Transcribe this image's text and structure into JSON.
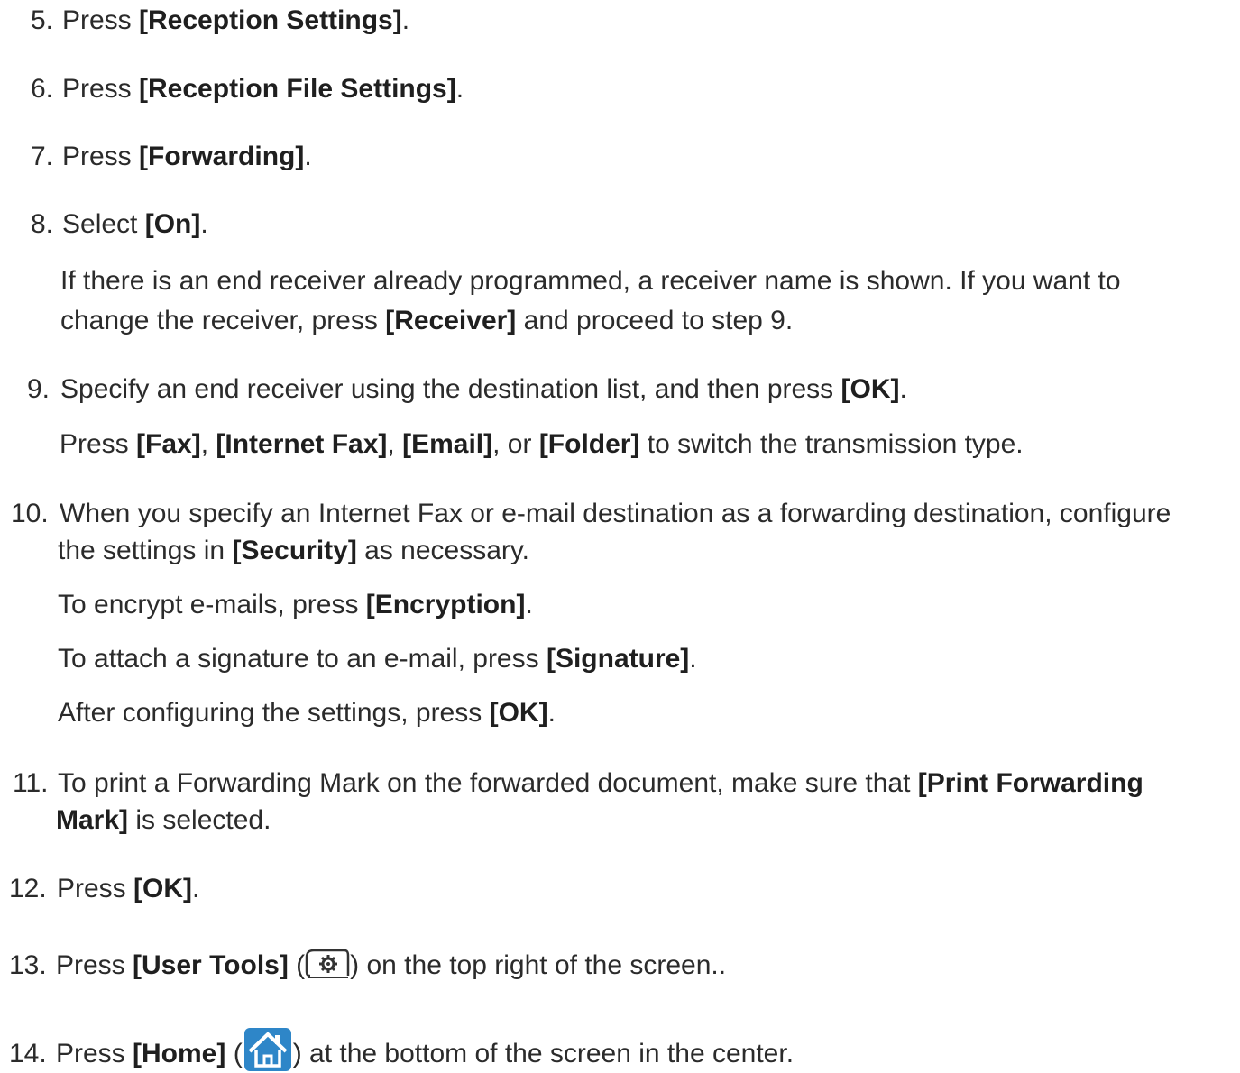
{
  "steps": [
    {
      "num": "5.",
      "parts": [
        {
          "t": "Press "
        },
        {
          "t": "[Reception Settings]",
          "b": true
        },
        {
          "t": "."
        }
      ]
    },
    {
      "num": "6.",
      "parts": [
        {
          "t": "Press "
        },
        {
          "t": "[Reception File Settings]",
          "b": true
        },
        {
          "t": "."
        }
      ]
    },
    {
      "num": "7.",
      "parts": [
        {
          "t": "Press "
        },
        {
          "t": "[Forwarding]",
          "b": true
        },
        {
          "t": "."
        }
      ]
    },
    {
      "num": "8.",
      "parts": [
        {
          "t": "Select "
        },
        {
          "t": "[On]",
          "b": true
        },
        {
          "t": "."
        }
      ]
    },
    {
      "num": "",
      "parts": [
        {
          "t": "If there is an end receiver already programmed, a receiver name is shown. If you want to"
        }
      ]
    },
    {
      "num": "",
      "parts": [
        {
          "t": "change the receiver, press "
        },
        {
          "t": "[Receiver]",
          "b": true
        },
        {
          "t": " and proceed to step 9."
        }
      ]
    },
    {
      "num": "9.",
      "parts": [
        {
          "t": "Specify an end receiver using the destination list, and then press "
        },
        {
          "t": "[OK]",
          "b": true
        },
        {
          "t": "."
        }
      ]
    },
    {
      "num": "",
      "parts": [
        {
          "t": "Press "
        },
        {
          "t": "[Fax]",
          "b": true
        },
        {
          "t": ", "
        },
        {
          "t": "[Internet Fax]",
          "b": true
        },
        {
          "t": ", "
        },
        {
          "t": "[Email]",
          "b": true
        },
        {
          "t": ", or "
        },
        {
          "t": "[Folder]",
          "b": true
        },
        {
          "t": " to switch the transmission type."
        }
      ]
    },
    {
      "num": "10.",
      "parts": [
        {
          "t": "When you specify an Internet Fax or e-mail destination as a forwarding destination, configure"
        }
      ]
    },
    {
      "num": "",
      "parts": [
        {
          "t": "the settings in "
        },
        {
          "t": "[Security]",
          "b": true
        },
        {
          "t": " as necessary."
        }
      ]
    },
    {
      "num": "",
      "parts": [
        {
          "t": "To encrypt e-mails, press "
        },
        {
          "t": "[Encryption]",
          "b": true
        },
        {
          "t": "."
        }
      ]
    },
    {
      "num": "",
      "parts": [
        {
          "t": "To attach a signature to an e-mail, press "
        },
        {
          "t": "[Signature]",
          "b": true
        },
        {
          "t": "."
        }
      ]
    },
    {
      "num": "",
      "parts": [
        {
          "t": "After configuring the settings, press "
        },
        {
          "t": "[OK]",
          "b": true
        },
        {
          "t": "."
        }
      ]
    },
    {
      "num": "11.",
      "parts": [
        {
          "t": "To print a Forwarding Mark on the forwarded document, make sure that "
        },
        {
          "t": "[Print Forwarding",
          "b": true
        }
      ]
    },
    {
      "num": "",
      "parts": [
        {
          "t": "Mark]",
          "b": true
        },
        {
          "t": " is selected."
        }
      ]
    },
    {
      "num": "12.",
      "parts": [
        {
          "t": "Press "
        },
        {
          "t": "[OK]",
          "b": true
        },
        {
          "t": "."
        }
      ]
    },
    {
      "num": "13.",
      "parts": [
        {
          "t": "Press "
        },
        {
          "t": "[User Tools]",
          "b": true
        },
        {
          "t": " ("
        },
        {
          "icon": "gear-icon"
        },
        {
          "t": ") on the top right of the screen.."
        }
      ]
    },
    {
      "num": "14.",
      "parts": [
        {
          "t": "Press "
        },
        {
          "t": "[Home]",
          "b": true
        },
        {
          "t": " ("
        },
        {
          "icon": "home-icon"
        },
        {
          "t": ") at the bottom of the screen in the center."
        }
      ]
    }
  ],
  "colors": {
    "text": "#2b2b2b",
    "home_icon_blue": "#2e86c8"
  }
}
